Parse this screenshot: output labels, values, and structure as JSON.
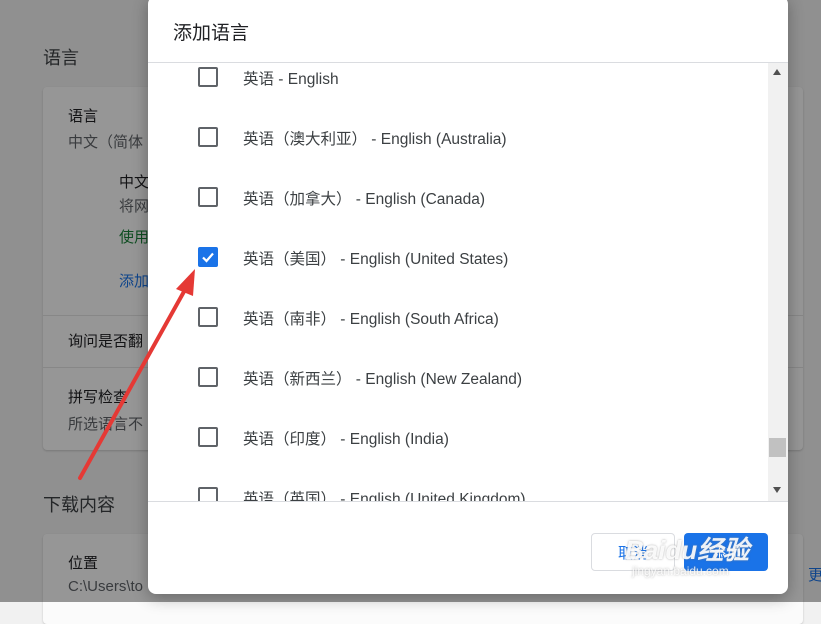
{
  "background": {
    "language_section_title": "语言",
    "language_card": {
      "label": "语言",
      "value_partial": "中文（简体",
      "sub_item_label": "中文",
      "sub_item_desc": "将网",
      "sub_item_status": "使用",
      "add_link": "添加",
      "ask_translate": "询问是否翻",
      "spellcheck_label": "拼写检查",
      "spellcheck_desc": "所选语言不"
    },
    "downloads_section_title": "下载内容",
    "downloads_card": {
      "location_label": "位置",
      "location_value": "C:\\Users\\to",
      "change_link": "更"
    }
  },
  "dialog": {
    "title": "添加语言",
    "languages": [
      {
        "label": "英语 - English",
        "checked": false
      },
      {
        "label": "英语（澳大利亚） - English (Australia)",
        "checked": false
      },
      {
        "label": "英语（加拿大） - English (Canada)",
        "checked": false
      },
      {
        "label": "英语（美国） - English (United States)",
        "checked": true
      },
      {
        "label": "英语（南非） - English (South Africa)",
        "checked": false
      },
      {
        "label": "英语（新西兰） - English (New Zealand)",
        "checked": false
      },
      {
        "label": "英语（印度） - English (India)",
        "checked": false
      },
      {
        "label": "英语（英国） - English (United Kingdom)",
        "checked": false
      }
    ],
    "cancel_label": "取消",
    "add_label": "添加"
  },
  "watermark": {
    "brand": "Baidu经验",
    "url": "jingyan.baidu.com"
  },
  "colors": {
    "accent": "#1a73e8",
    "arrow": "#e53935"
  }
}
